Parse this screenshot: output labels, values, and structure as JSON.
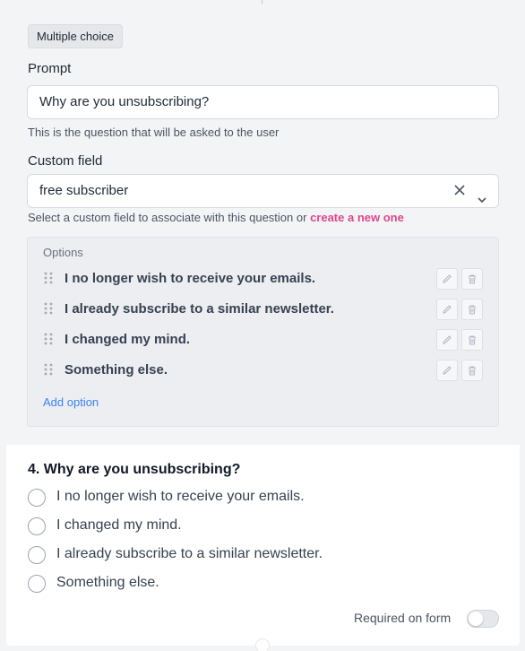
{
  "editor": {
    "type_badge": "Multiple choice",
    "prompt_label": "Prompt",
    "prompt_value": "Why are you unsubscribing?",
    "prompt_help": "This is the question that will be asked to the user",
    "custom_field_label": "Custom field",
    "custom_field_value": "free subscriber",
    "custom_field_help": "Select a custom field to associate with this question or",
    "custom_field_link": "create a new one",
    "options_title": "Options",
    "options": [
      {
        "label": "I no longer wish to receive your emails."
      },
      {
        "label": "I already subscribe to a similar newsletter."
      },
      {
        "label": "I changed my mind."
      },
      {
        "label": "Something else."
      }
    ],
    "add_option": "Add option"
  },
  "preview": {
    "title": "4.  Why are you unsubscribing?",
    "choices": [
      "I no longer wish to receive your emails.",
      "I changed my mind.",
      "I already subscribe to a similar newsletter.",
      "Something else."
    ],
    "required_label": "Required on form",
    "required_on": false
  },
  "colors": {
    "link_pink": "#e0468c",
    "link_blue": "#3b82f6"
  },
  "icons": [
    "close-icon",
    "chevron-down-icon",
    "drag-handle-icon",
    "pencil-icon",
    "trash-icon"
  ]
}
